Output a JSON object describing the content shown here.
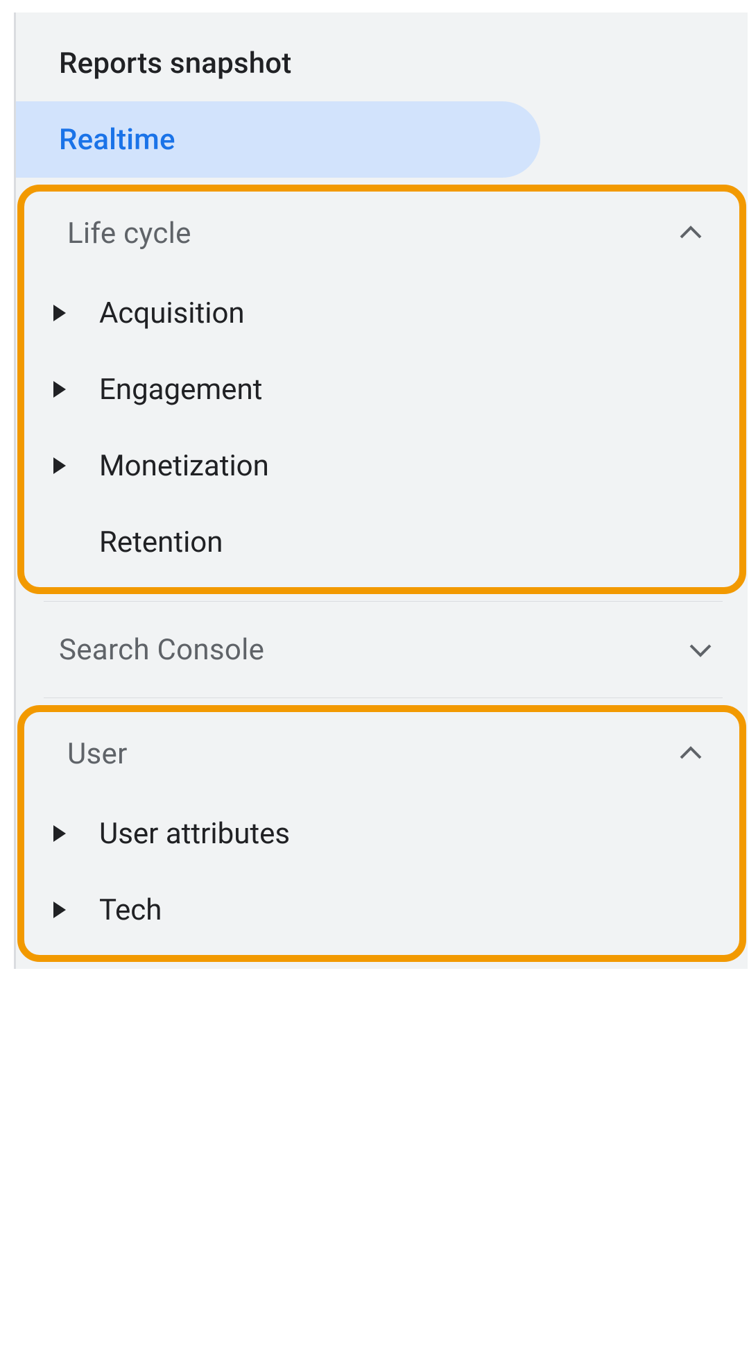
{
  "nav": {
    "reports_snapshot": "Reports snapshot",
    "realtime": "Realtime"
  },
  "sections": {
    "life_cycle": {
      "label": "Life cycle",
      "items": {
        "acquisition": "Acquisition",
        "engagement": "Engagement",
        "monetization": "Monetization",
        "retention": "Retention"
      }
    },
    "search_console": {
      "label": "Search Console"
    },
    "user": {
      "label": "User",
      "items": {
        "user_attributes": "User attributes",
        "tech": "Tech"
      }
    }
  },
  "icons": {
    "chevron_up": "chevron-up-icon",
    "chevron_down": "chevron-down-icon",
    "expand_triangle": "expand-right-icon"
  }
}
